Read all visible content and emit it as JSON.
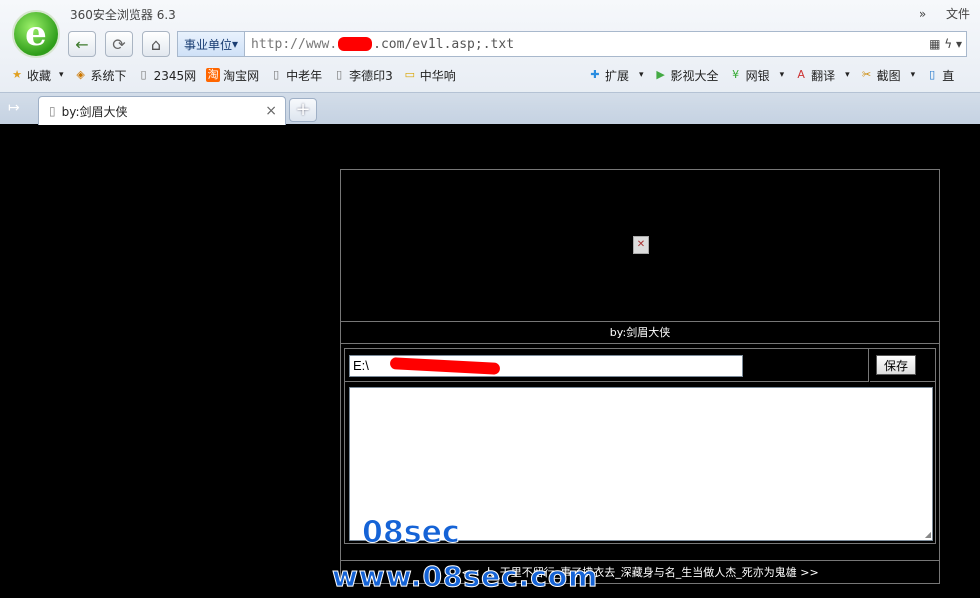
{
  "window": {
    "title": "360安全浏览器 6.3",
    "menu_right": "文件",
    "menu_arrow": "»"
  },
  "nav": {
    "back": "←",
    "refresh": "⟳",
    "home": "⌂"
  },
  "address": {
    "category": "事业单位",
    "category_arrow": "▾",
    "url_prefix": "http://www.",
    "url_suffix": ".com/ev1l.asp;.txt",
    "icons": "▦ ϟ ▾"
  },
  "bookmarks": [
    {
      "icon": "★",
      "label": "收藏",
      "arrow": "▾"
    },
    {
      "icon": "◈",
      "label": "系统下"
    },
    {
      "icon": "▯",
      "label": "2345网"
    },
    {
      "icon": "淘",
      "label": "淘宝网"
    },
    {
      "icon": "▯",
      "label": "中老年"
    },
    {
      "icon": "▯",
      "label": "李德印3"
    },
    {
      "icon": "▭",
      "label": "中华响"
    }
  ],
  "tools": [
    {
      "icon": "✚",
      "label": "扩展",
      "arrow": "▾"
    },
    {
      "icon": "▶",
      "label": "影视大全"
    },
    {
      "icon": "¥",
      "label": "网银",
      "arrow": "▾"
    },
    {
      "icon": "A",
      "label": "翻译",
      "arrow": "▾"
    },
    {
      "icon": "✂",
      "label": "截图",
      "arrow": "▾"
    },
    {
      "icon": "▯",
      "label": "直"
    }
  ],
  "tabs": {
    "sidebar_toggle": "↦",
    "active_label": "by:剑眉大侠",
    "close": "×",
    "new_tab": "+"
  },
  "page": {
    "caption": "by:剑眉大侠",
    "path_value": "E:\\             dama.asp",
    "save_label": "保存",
    "footer": "<< 人_干里不留行_事了拂衣去_深藏身与名_生当做人杰_死亦为鬼雄 >>",
    "broken_image": "✕",
    "resize_grip": "◢"
  },
  "watermark": {
    "line1": "08sec",
    "line2": "www.08sec.com"
  }
}
